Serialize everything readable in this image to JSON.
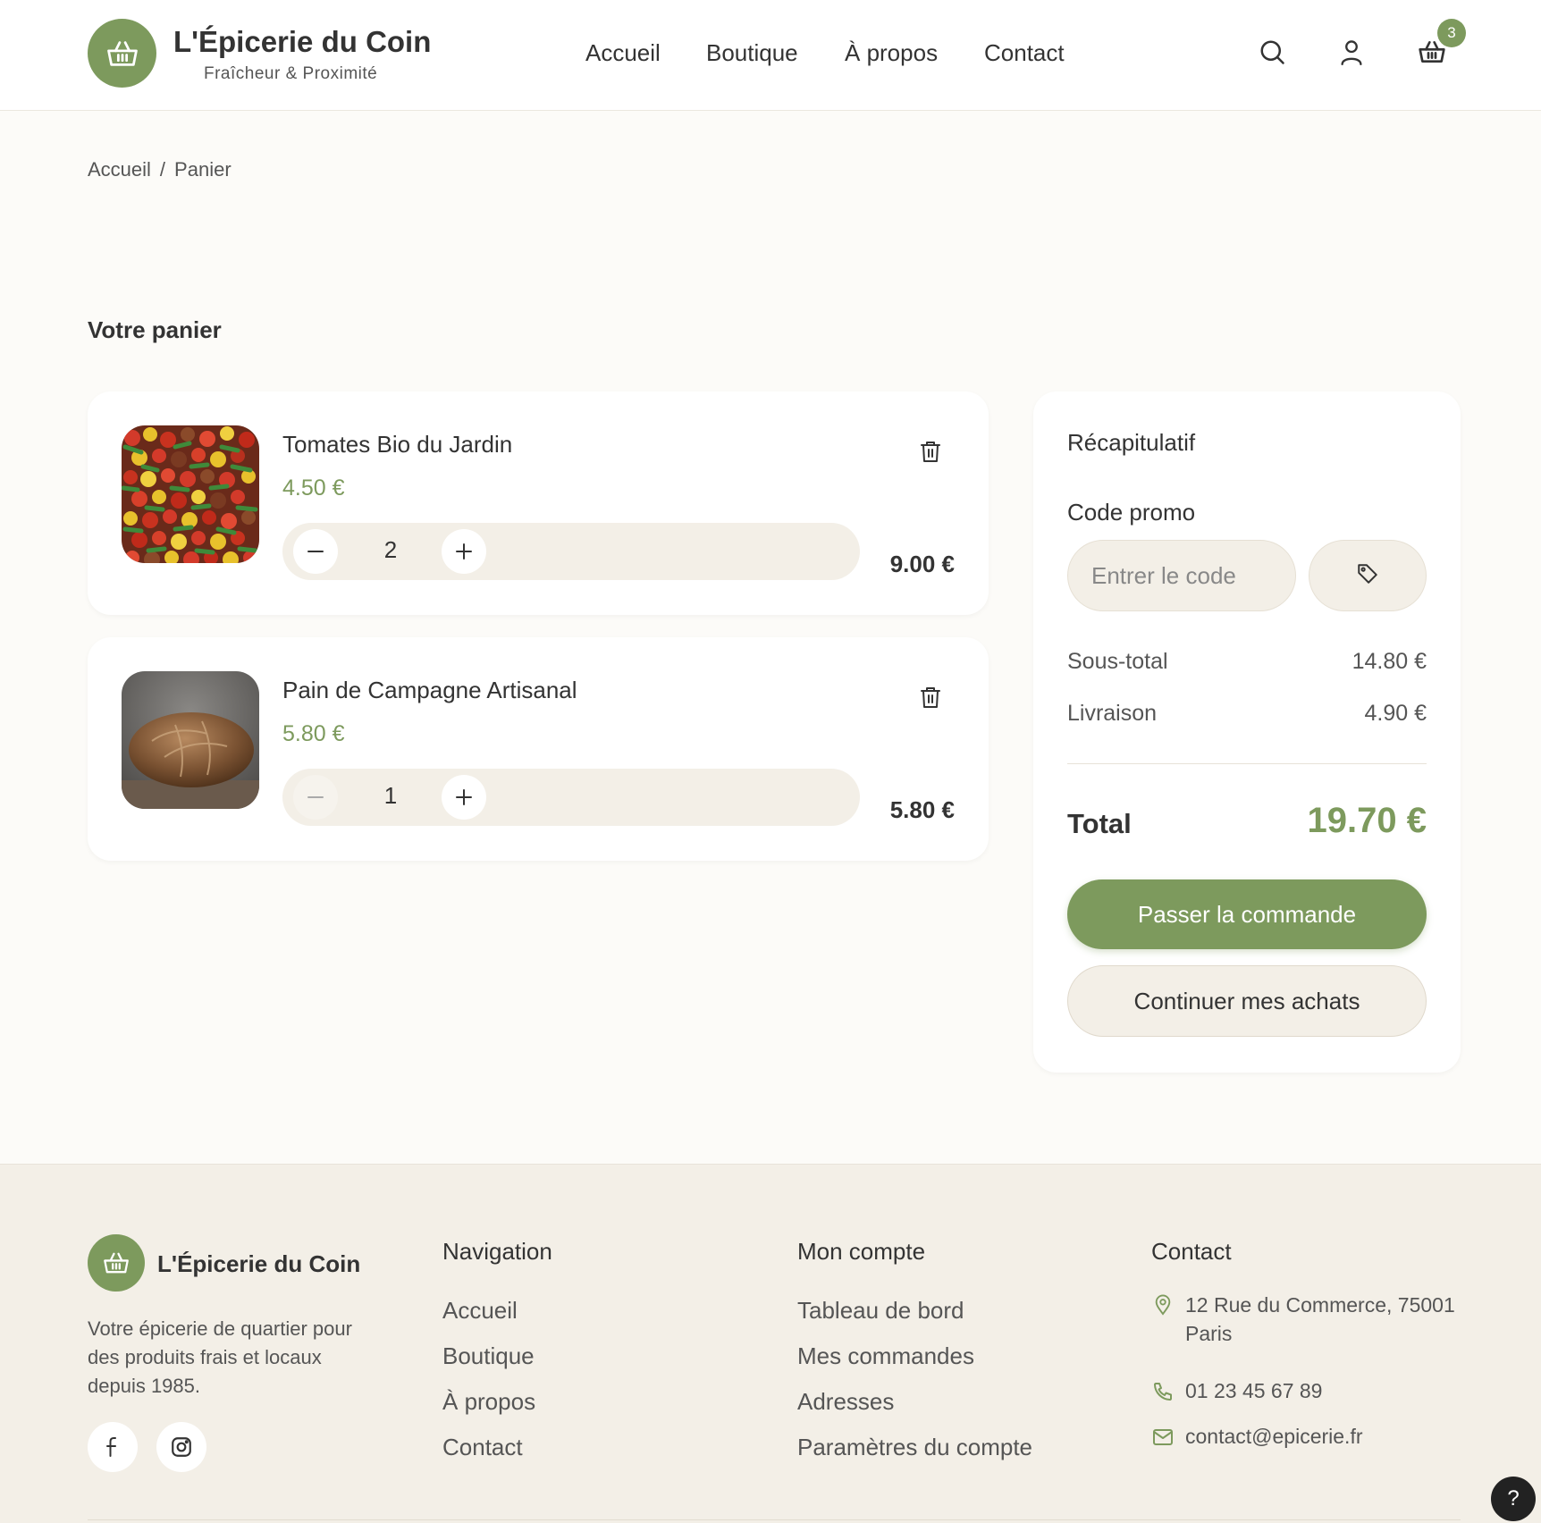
{
  "header": {
    "brand_name": "L'Épicerie du Coin",
    "brand_tagline": "Fraîcheur & Proximité",
    "nav": [
      "Accueil",
      "Boutique",
      "À propos",
      "Contact"
    ],
    "cart_count": "3"
  },
  "breadcrumb": {
    "home": "Accueil",
    "separator": "/",
    "current": "Panier"
  },
  "cart": {
    "title": "Votre panier",
    "items": [
      {
        "name": "Tomates Bio du Jardin",
        "price": "4.50 €",
        "quantity": "2",
        "line_total": "9.00 €",
        "image": "tomatoes-photo"
      },
      {
        "name": "Pain de Campagne Artisanal",
        "price": "5.80 €",
        "quantity": "1",
        "line_total": "5.80 €",
        "image": "bread-photo"
      }
    ]
  },
  "summary": {
    "title": "Récapitulatif",
    "promo_label": "Code promo",
    "promo_placeholder": "Entrer le code",
    "subtotal_label": "Sous-total",
    "subtotal_value": "14.80 €",
    "shipping_label": "Livraison",
    "shipping_value": "4.90 €",
    "total_label": "Total",
    "total_value": "19.70 €",
    "checkout_label": "Passer la commande",
    "continue_label": "Continuer mes achats"
  },
  "footer": {
    "brand_name": "L'Épicerie du Coin",
    "description": "Votre épicerie de quartier pour des produits frais et locaux depuis 1985.",
    "navigation": {
      "title": "Navigation",
      "links": [
        "Accueil",
        "Boutique",
        "À propos",
        "Contact"
      ]
    },
    "account": {
      "title": "Mon compte",
      "links": [
        "Tableau de bord",
        "Mes commandes",
        "Adresses",
        "Paramètres du compte"
      ]
    },
    "contact": {
      "title": "Contact",
      "address_line1": "12 Rue du Commerce, 75001",
      "address_line2": "Paris",
      "phone": "01 23 45 67 89",
      "email": "contact@epicerie.fr"
    }
  },
  "help_label": "?",
  "colors": {
    "accent": "#7d9a5d",
    "background": "#fcfbf8",
    "beige": "#f3efe7"
  }
}
